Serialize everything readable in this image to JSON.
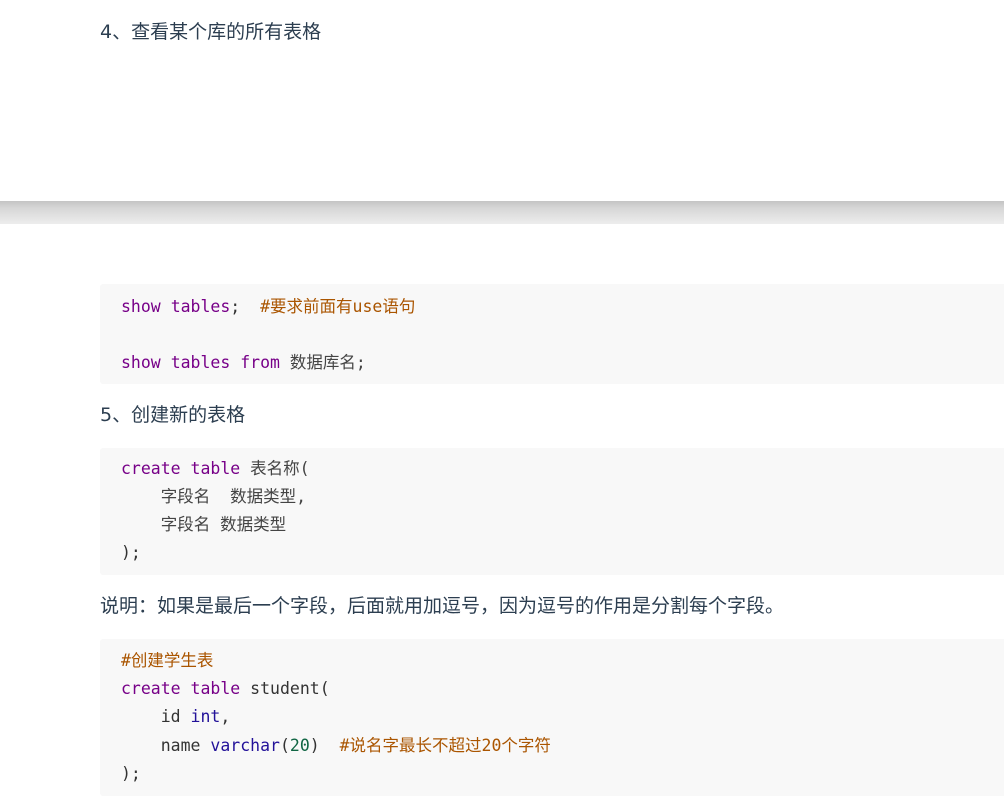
{
  "headings": {
    "h4": "4、查看某个库的所有表格",
    "h5": "5、创建新的表格"
  },
  "note": "说明：如果是最后一个字段，后面就用加逗号，因为逗号的作用是分割每个字段。",
  "code1": {
    "line1": {
      "kw1": "show",
      "sp1": " ",
      "kw2": "tables",
      "tail": ";  ",
      "comment": "#要求前面有use语句"
    },
    "line2": {
      "kw1": "show",
      "sp1": " ",
      "kw2": "tables",
      "sp2": " ",
      "kw3": "from",
      "tail": " 数据库名;"
    }
  },
  "code2": {
    "line1": {
      "kw1": "create",
      "sp1": " ",
      "kw2": "table",
      "tail": " 表名称("
    },
    "line2": "    字段名  数据类型,",
    "line3": "    字段名 数据类型",
    "line4": ");"
  },
  "code3": {
    "line1": "#创建学生表",
    "line2": {
      "kw1": "create",
      "sp1": " ",
      "kw2": "table",
      "tail": " student("
    },
    "line3": {
      "lead": "    id ",
      "type": "int",
      "tail": ","
    },
    "line4": {
      "lead": "    name ",
      "type": "varchar",
      "open": "(",
      "num": "20",
      "close": ")  ",
      "comment": "#说名字最长不超过20个字符"
    },
    "line5": ");"
  }
}
